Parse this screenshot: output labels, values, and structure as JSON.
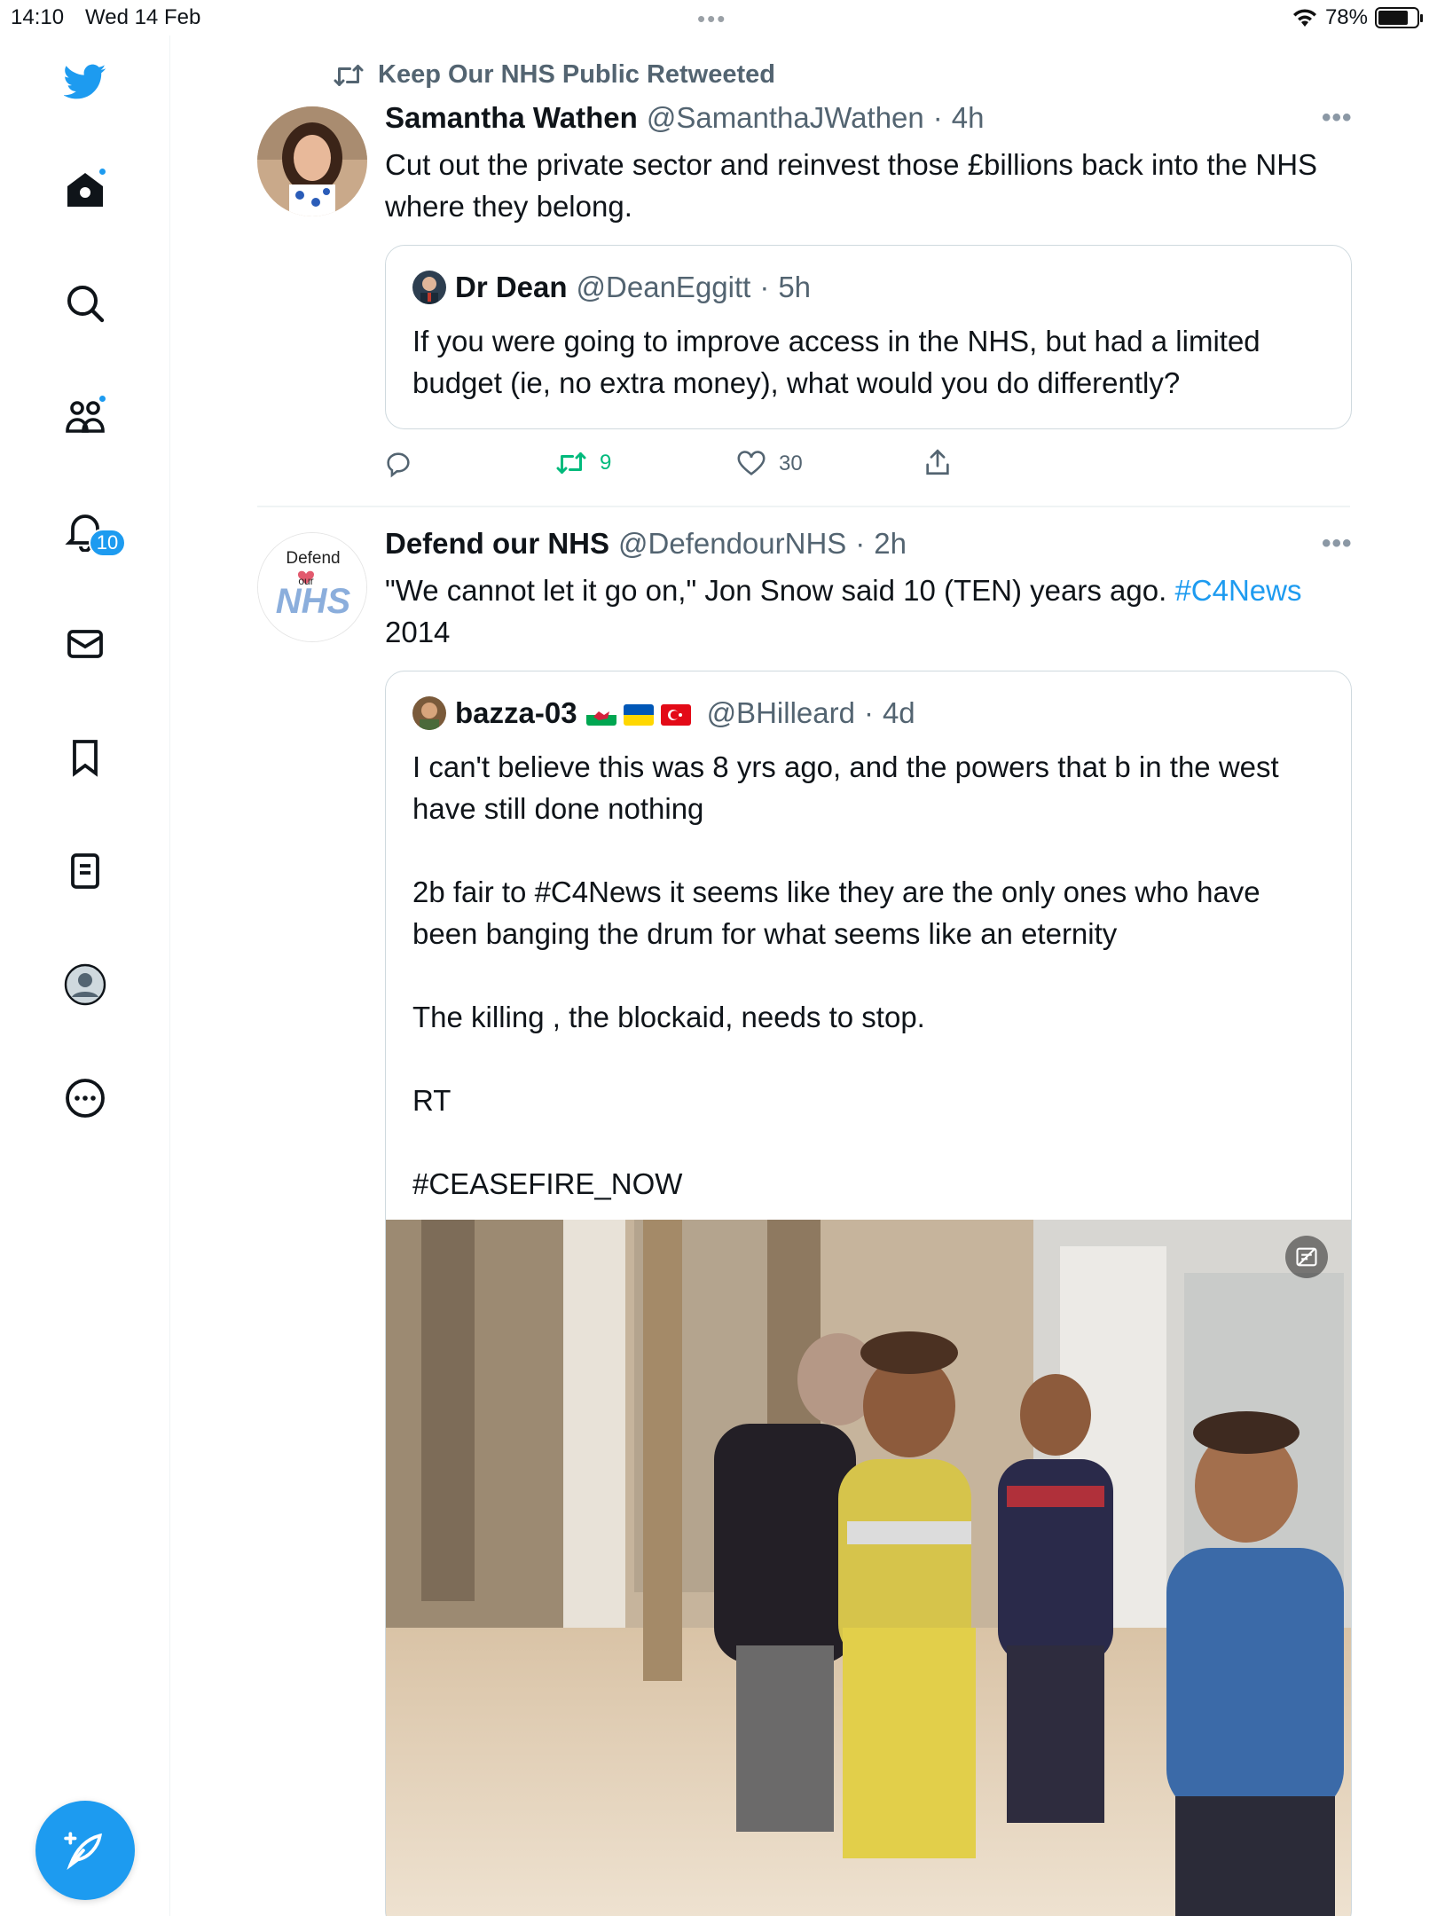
{
  "status_bar": {
    "time": "14:10",
    "date": "Wed 14 Feb",
    "battery": "78%",
    "battery_level": 0.78
  },
  "sidebar": {
    "notifications_badge": "10",
    "accent": "#1d9bf0"
  },
  "tweet1": {
    "retweet_note": "Keep Our NHS Public Retweeted",
    "name": "Samantha Wathen",
    "handle": "@SamanthaJWathen",
    "time": "4h",
    "text": "Cut out the private sector and reinvest those £billions back into the NHS where they belong.",
    "quote": {
      "name": "Dr Dean",
      "handle": "@DeanEggitt",
      "time": "5h",
      "text": "If you were going to improve access in the NHS, but had a limited budget (ie, no extra money), what would you do differently?"
    },
    "retweets": "9",
    "likes": "30"
  },
  "tweet2": {
    "name": "Defend our NHS",
    "handle": "@DefendourNHS",
    "time": "2h",
    "text_before": "\"We cannot let it go on,\" Jon Snow said 10 (TEN) years ago. ",
    "hashtag": "#C4News",
    "text_after": "2014",
    "avatar_text_top": "Defend",
    "avatar_text_mid": "our",
    "avatar_text_bottom": "NHS",
    "quote": {
      "name": "bazza-03",
      "handle": "@BHilleard",
      "time": "4d",
      "text": "I can't believe this was 8 yrs ago, and the powers that b in the west have still done nothing\n\n2b fair to #C4News it seems like they are the only ones who have been banging the drum for what seems like an eternity\n\nThe killing , the blockaid, needs to stop.\n\nRT\n\n#CEASEFIRE_NOW"
    }
  }
}
